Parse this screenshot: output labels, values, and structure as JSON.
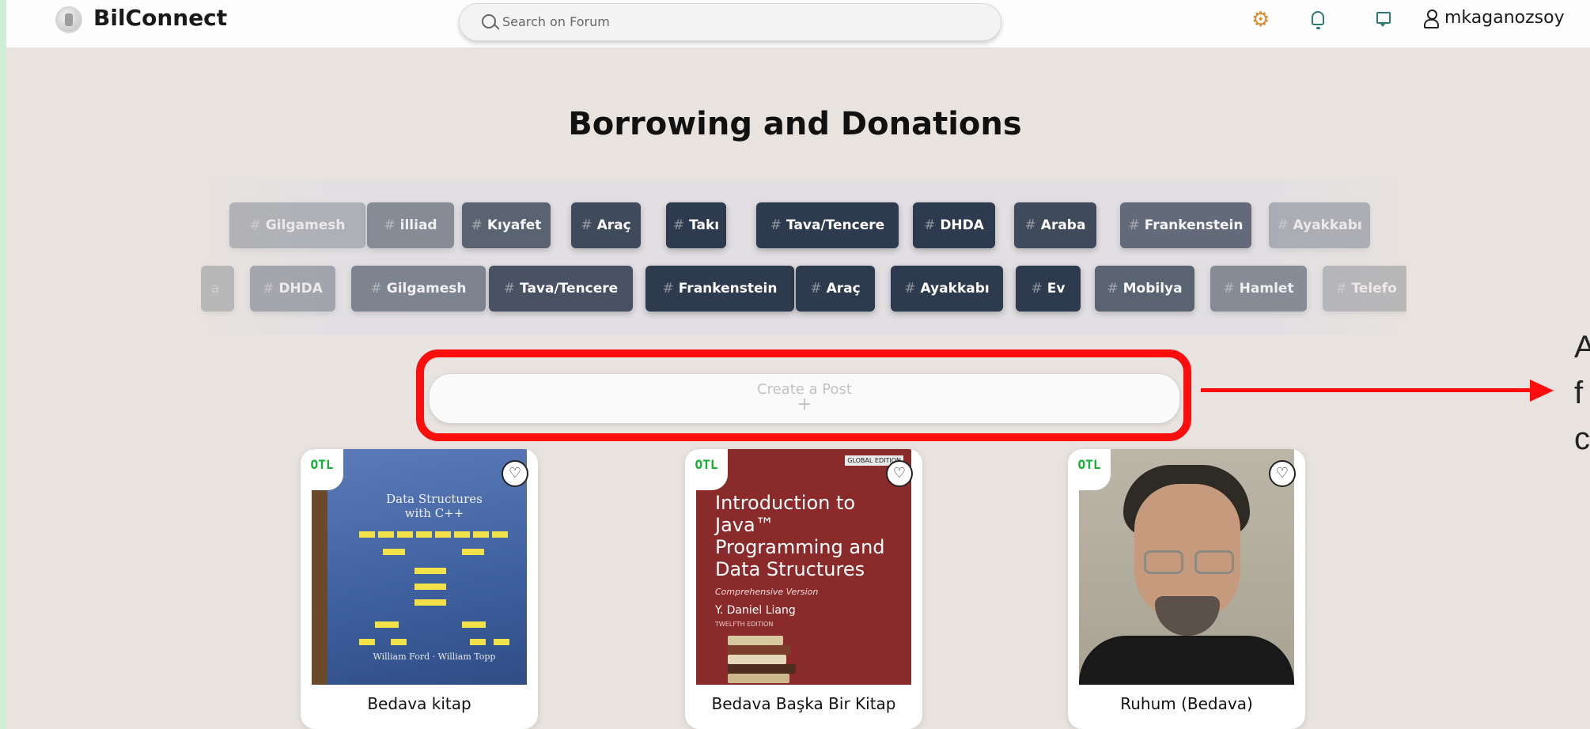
{
  "app": {
    "brand": "BilConnect"
  },
  "search": {
    "placeholder": "Search on Forum"
  },
  "header": {
    "username": "mkaganozsoy"
  },
  "page": {
    "title": "Borrowing and Donations"
  },
  "tags_row1": [
    "Gilgamesh",
    "illiad",
    "Kıyafet",
    "Araç",
    "Takı",
    "Tava/Tencere",
    "DHDA",
    "Araba",
    "Frankenstein",
    "Ayakkabı"
  ],
  "tags_row2": [
    "DHDA",
    "Gilgamesh",
    "Tava/Tencere",
    "Frankenstein",
    "Araç",
    "Ayakkabı",
    "Ev",
    "Mobilya",
    "Hamlet",
    "Telefo"
  ],
  "create_post": {
    "label": "Create a Post",
    "plus": "+"
  },
  "posts": [
    {
      "badge": "OTL",
      "caption": "Bedava kitap",
      "image": {
        "title_line1": "Data Structures",
        "title_line2": "with C++",
        "authors": "William Ford  ·  William Topp"
      }
    },
    {
      "badge": "OTL",
      "caption": "Bedava Başka Bir Kitap",
      "image": {
        "badge": "GLOBAL EDITION",
        "title": "Introduction to Java™ Programming and Data Structures",
        "subtitle": "Comprehensive Version",
        "author": "Y. Daniel Liang",
        "edition": "TWELFTH EDITION"
      }
    },
    {
      "badge": "OTL",
      "caption": "Ruhum (Bedava)"
    }
  ],
  "annotation": {
    "text": "A\nf\nc"
  },
  "colors": {
    "accent_red": "#ff0d0d",
    "badge_green": "#11b22d",
    "tag_bg": "#2e3a4d"
  }
}
